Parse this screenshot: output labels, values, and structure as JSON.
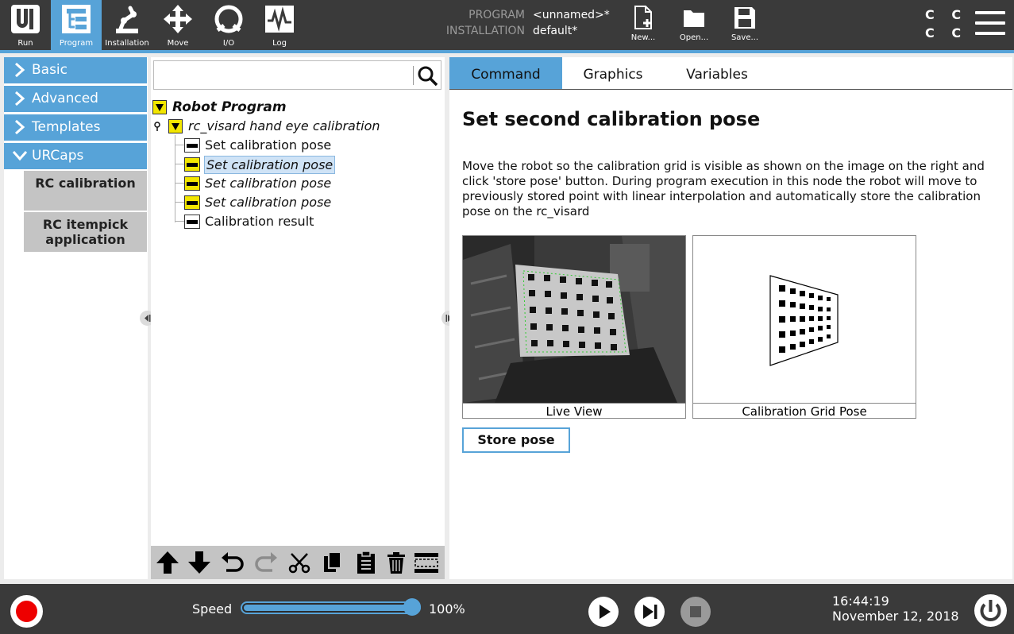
{
  "header": {
    "nav": [
      {
        "label": "Run",
        "icon": "ur-logo-icon"
      },
      {
        "label": "Program",
        "icon": "program-tree-icon",
        "active": true
      },
      {
        "label": "Installation",
        "icon": "robot-arm-icon"
      },
      {
        "label": "Move",
        "icon": "move-arrows-icon"
      },
      {
        "label": "I/O",
        "icon": "io-icon"
      },
      {
        "label": "Log",
        "icon": "log-icon"
      }
    ],
    "program_label": "PROGRAM",
    "program_value": "<unnamed>*",
    "installation_label": "INSTALLATION",
    "installation_value": "default*",
    "file_buttons": [
      {
        "label": "New...",
        "icon": "new-file-icon"
      },
      {
        "label": "Open...",
        "icon": "folder-icon"
      },
      {
        "label": "Save...",
        "icon": "save-icon"
      }
    ],
    "cc_top": "C C",
    "cc_bottom": "C C",
    "accent_color": "#57a3d8"
  },
  "left_panel": {
    "categories": [
      {
        "label": "Basic",
        "expanded": false
      },
      {
        "label": "Advanced",
        "expanded": false
      },
      {
        "label": "Templates",
        "expanded": false
      },
      {
        "label": "URCaps",
        "expanded": true
      }
    ],
    "urcaps": [
      "RC calibration",
      "RC itempick application"
    ]
  },
  "tree": {
    "search_placeholder": "",
    "root": "Robot Program",
    "sub": "rc_visard hand eye calibration",
    "nodes": [
      {
        "label": "Set calibration pose",
        "style": "normal"
      },
      {
        "label": "Set calibration pose",
        "style": "selected"
      },
      {
        "label": "Set calibration pose",
        "style": "italic"
      },
      {
        "label": "Set calibration pose",
        "style": "italic"
      },
      {
        "label": "Calibration result",
        "style": "normal"
      }
    ],
    "toolbar": [
      "move-up-icon",
      "move-down-icon",
      "undo-icon",
      "redo-icon",
      "cut-icon",
      "copy-icon",
      "paste-icon",
      "delete-icon",
      "suppress-icon"
    ]
  },
  "right_panel": {
    "tabs": [
      {
        "label": "Command",
        "active": true
      },
      {
        "label": "Graphics",
        "active": false
      },
      {
        "label": "Variables",
        "active": false
      }
    ],
    "title": "Set second calibration pose",
    "description": "Move the robot so the calibration grid is visible as shown on the image on the right and click 'store pose' button. During program execution in this node the robot will move to previously stored point with linear interpolation and automatically store the calibration pose on the rc_visard",
    "live_view_caption": "Live View",
    "grid_pose_caption": "Calibration Grid Pose",
    "store_pose_label": "Store pose"
  },
  "footer": {
    "speed_label": "Speed",
    "speed_value": "100%",
    "speed_fraction": 1.0,
    "time": "16:44:19",
    "date": "November 12, 2018",
    "record_color": "#ee0000"
  }
}
